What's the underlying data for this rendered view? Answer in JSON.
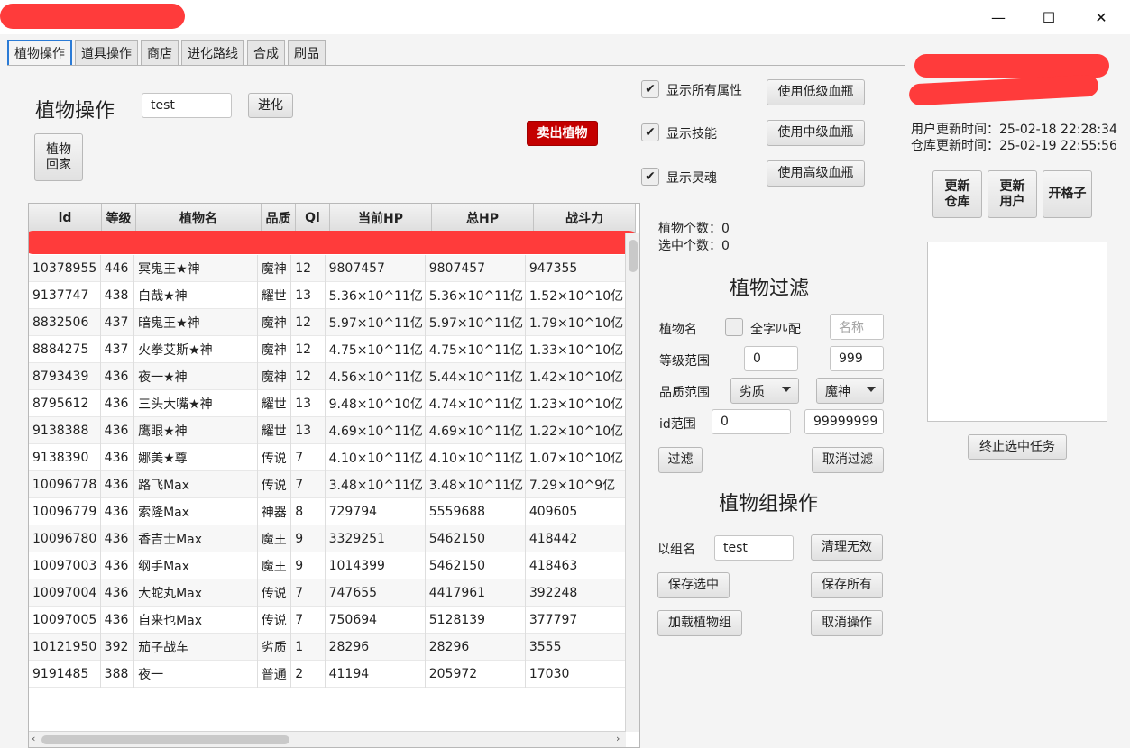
{
  "window": {
    "minimize_icon": "—",
    "maximize_icon": "☐",
    "close_icon": "✕"
  },
  "tabs": [
    "植物操作",
    "道具操作",
    "商店",
    "进化路线",
    "合成",
    "刷品"
  ],
  "plant_ops": {
    "heading": "植物操作",
    "name_value": "test",
    "evolve_button": "进化",
    "return_button_line1": "植物",
    "return_button_line2": "回家",
    "sell_button": "卖出植物"
  },
  "options": {
    "show_all_attr": "显示所有属性",
    "show_skills": "显示技能",
    "show_soul": "显示灵魂",
    "low_potion": "使用低级血瓶",
    "mid_potion": "使用中级血瓶",
    "high_potion": "使用高级血瓶"
  },
  "counts": {
    "plant_count": "植物个数：0",
    "selected_count": "选中个数：0"
  },
  "filter": {
    "heading": "植物过滤",
    "name_label": "植物名",
    "exact_match": "全字匹配",
    "name_placeholder": "名称",
    "level_label": "等级范围",
    "level_min": "0",
    "level_max": "999",
    "quality_label": "品质范围",
    "quality_min": "劣质",
    "quality_max": "魔神",
    "id_label": "id范围",
    "id_min": "0",
    "id_max": "99999999",
    "filter_button": "过滤",
    "cancel_filter_button": "取消过滤"
  },
  "group": {
    "heading": "植物组操作",
    "group_name_label": "以组名",
    "group_name_value": "test",
    "clean_invalid": "清理无效",
    "save_selected": "保存选中",
    "save_all": "保存所有",
    "load_group": "加载植物组",
    "cancel_op": "取消操作"
  },
  "table": {
    "columns": [
      "id",
      "等级",
      "植物名",
      "品质",
      "Qi",
      "当前HP",
      "总HP",
      "战斗力"
    ],
    "rows": [
      [
        "10378955",
        "446",
        "冥鬼王★神",
        "魔神",
        "12",
        "9807457",
        "9807457",
        "947355"
      ],
      [
        "9137747",
        "438",
        "白哉★神",
        "耀世",
        "13",
        "5.36×10^11亿",
        "5.36×10^11亿",
        "1.52×10^10亿"
      ],
      [
        "8832506",
        "437",
        "暗鬼王★神",
        "魔神",
        "12",
        "5.97×10^11亿",
        "5.97×10^11亿",
        "1.79×10^10亿"
      ],
      [
        "8884275",
        "437",
        "火拳艾斯★神",
        "魔神",
        "12",
        "4.75×10^11亿",
        "4.75×10^11亿",
        "1.33×10^10亿"
      ],
      [
        "8793439",
        "436",
        "夜一★神",
        "魔神",
        "12",
        "4.56×10^11亿",
        "5.44×10^11亿",
        "1.42×10^10亿"
      ],
      [
        "8795612",
        "436",
        "三头大嘴★神",
        "耀世",
        "13",
        "9.48×10^10亿",
        "4.74×10^11亿",
        "1.23×10^10亿"
      ],
      [
        "9138388",
        "436",
        "鹰眼★神",
        "耀世",
        "13",
        "4.69×10^11亿",
        "4.69×10^11亿",
        "1.22×10^10亿"
      ],
      [
        "9138390",
        "436",
        "娜美★尊",
        "传说",
        "7",
        "4.10×10^11亿",
        "4.10×10^11亿",
        "1.07×10^10亿"
      ],
      [
        "10096778",
        "436",
        "路飞Max",
        "传说",
        "7",
        "3.48×10^11亿",
        "3.48×10^11亿",
        "7.29×10^9亿"
      ],
      [
        "10096779",
        "436",
        "索隆Max",
        "神器",
        "8",
        "729794",
        "5559688",
        "409605"
      ],
      [
        "10096780",
        "436",
        "香吉士Max",
        "魔王",
        "9",
        "3329251",
        "5462150",
        "418442"
      ],
      [
        "10097003",
        "436",
        "纲手Max",
        "魔王",
        "9",
        "1014399",
        "5462150",
        "418463"
      ],
      [
        "10097004",
        "436",
        "大蛇丸Max",
        "传说",
        "7",
        "747655",
        "4417961",
        "392248"
      ],
      [
        "10097005",
        "436",
        "自来也Max",
        "传说",
        "7",
        "750694",
        "5128139",
        "377797"
      ],
      [
        "10121950",
        "392",
        "茄子战车",
        "劣质",
        "1",
        "28296",
        "28296",
        "3555"
      ],
      [
        "9191485",
        "388",
        "夜一",
        "普通",
        "2",
        "41194",
        "205972",
        "17030"
      ]
    ]
  },
  "right_panel": {
    "user_update": "用户更新时间：25-02-18 22:28:34",
    "warehouse_update": "仓库更新时间：25-02-19 22:55:56",
    "update_warehouse_1": "更新",
    "update_warehouse_2": "仓库",
    "update_user_1": "更新",
    "update_user_2": "用户",
    "open_slot": "开格子",
    "stop_task": "终止选中任务"
  }
}
